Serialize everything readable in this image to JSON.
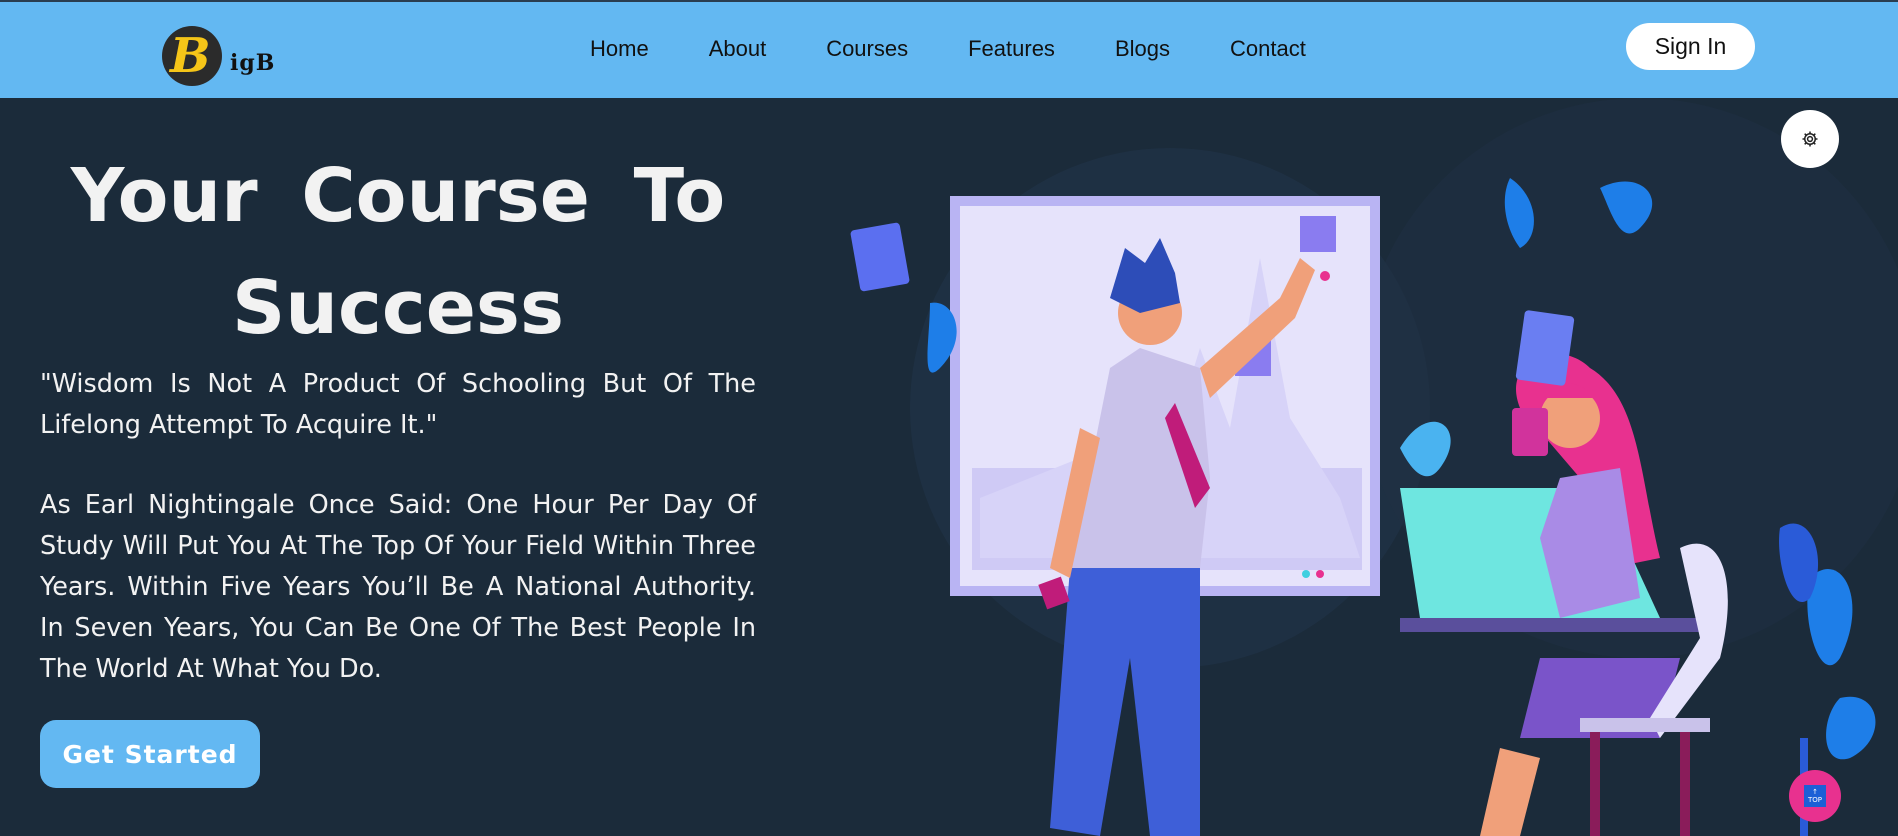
{
  "header": {
    "logo_letter": "B",
    "logo_text": "igB",
    "nav": [
      "Home",
      "About",
      "Courses",
      "Features",
      "Blogs",
      "Contact"
    ],
    "signin_label": "Sign In"
  },
  "hero": {
    "title_line1": "Your Course To",
    "title_line2": "Success",
    "quote": "\"Wisdom Is Not A Product Of Schooling But Of The Lifelong Attempt To Acquire It.\"",
    "paragraph": "As Earl Nightingale Once Said: One Hour Per Day Of Study Will Put You At The Top Of Your Field Within Three Years. Within Five Years You’ll Be A National Authority. In Seven Years, You Can Be One Of The Best People In The World At What You Do.",
    "cta_label": "Get Started"
  },
  "floating": {
    "settings_icon": "gear-icon",
    "top_icon": "arrow-up-icon",
    "top_label": "TOP"
  },
  "colors": {
    "header_bg": "#63b8f2",
    "page_bg": "#1b2b3a",
    "accent_pink": "#e8318f"
  }
}
